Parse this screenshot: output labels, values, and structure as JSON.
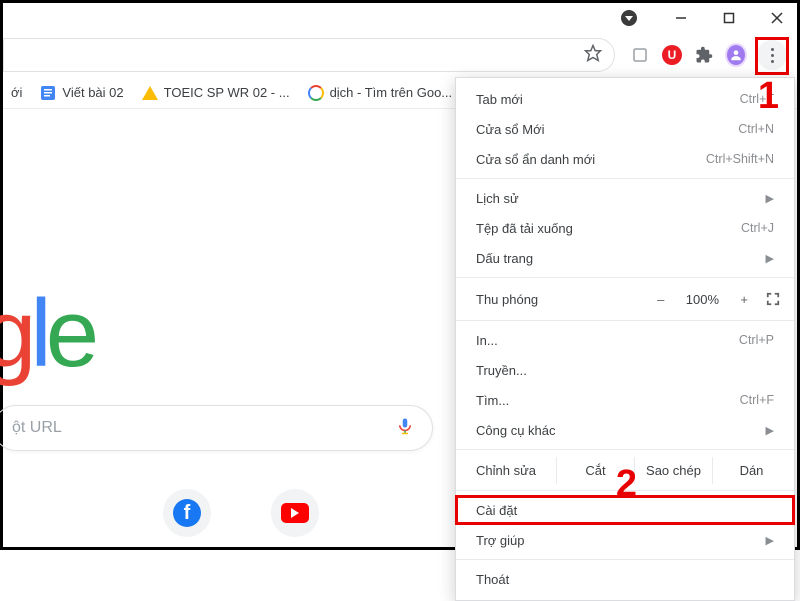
{
  "window_controls": {
    "circle_indicator": "notifications-icon"
  },
  "bookmarks": [
    {
      "icon": "folder",
      "label": "ới"
    },
    {
      "icon": "docs",
      "label": "Viết bài 02"
    },
    {
      "icon": "drive",
      "label": "TOEIC SP WR 02 - ..."
    },
    {
      "icon": "google",
      "label": "dịch - Tìm trên Goo..."
    }
  ],
  "search_placeholder": "ột URL",
  "quicklinks": [
    "facebook",
    "youtube"
  ],
  "menu": {
    "section1": [
      {
        "label": "Tab mới",
        "shortcut": "Ctrl+T"
      },
      {
        "label": "Cửa sổ Mới",
        "shortcut": "Ctrl+N"
      },
      {
        "label": "Cửa sổ ẩn danh mới",
        "shortcut": "Ctrl+Shift+N"
      }
    ],
    "section2": [
      {
        "label": "Lịch sử",
        "submenu": true
      },
      {
        "label": "Tệp đã tải xuống",
        "shortcut": "Ctrl+J"
      },
      {
        "label": "Dấu trang",
        "submenu": true
      }
    ],
    "zoom": {
      "label": "Thu phóng",
      "value": "100%",
      "minus": "–",
      "plus": "+"
    },
    "section3": [
      {
        "label": "In...",
        "shortcut": "Ctrl+P"
      },
      {
        "label": "Truyền..."
      },
      {
        "label": "Tìm...",
        "shortcut": "Ctrl+F"
      },
      {
        "label": "Công cụ khác",
        "submenu": true
      }
    ],
    "edit": {
      "label": "Chỉnh sửa",
      "cut": "Cắt",
      "copy": "Sao chép",
      "paste": "Dán"
    },
    "section4": [
      {
        "label": "Cài đặt",
        "highlight": true
      },
      {
        "label": "Trợ giúp",
        "submenu": true
      }
    ],
    "section5": [
      {
        "label": "Thoát"
      }
    ]
  },
  "annotations": {
    "one": "1",
    "two": "2"
  }
}
